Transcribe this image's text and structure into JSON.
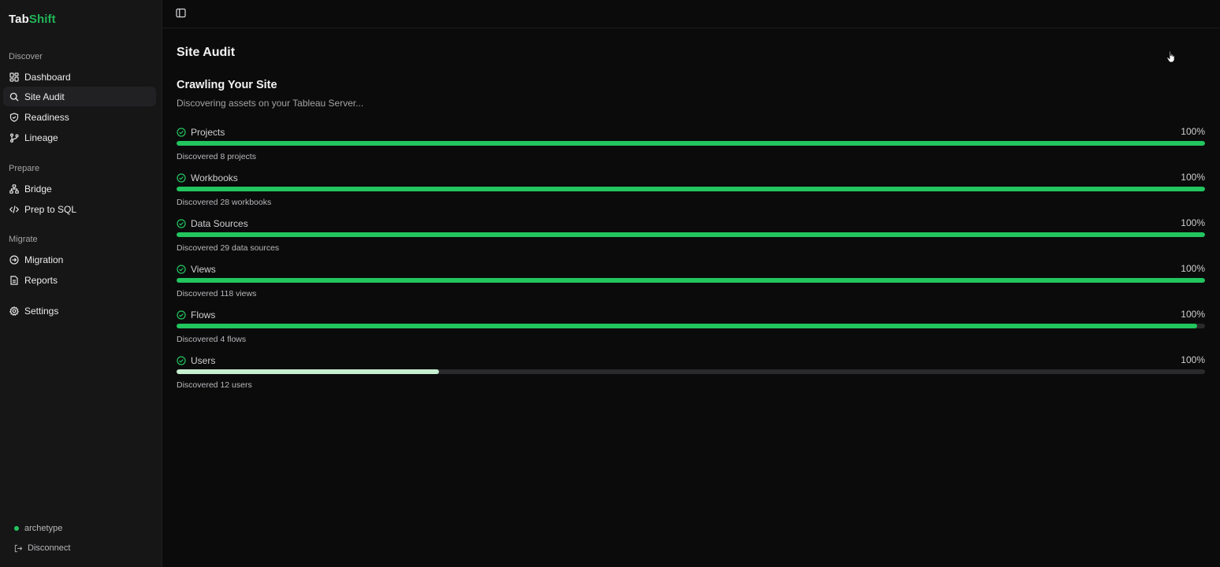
{
  "brand": {
    "part1": "Tab",
    "part2": "Shift"
  },
  "sidebar": {
    "sections": [
      {
        "label": "Discover"
      },
      {
        "label": "Prepare"
      },
      {
        "label": "Migrate"
      }
    ],
    "items": [
      {
        "label": "Dashboard",
        "icon": "grid-icon"
      },
      {
        "label": "Site Audit",
        "icon": "search-icon",
        "active": true
      },
      {
        "label": "Readiness",
        "icon": "shield-icon"
      },
      {
        "label": "Lineage",
        "icon": "branch-icon"
      },
      {
        "label": "Bridge",
        "icon": "network-icon"
      },
      {
        "label": "Prep to SQL",
        "icon": "code-icon"
      },
      {
        "label": "Migration",
        "icon": "arrow-circle-icon"
      },
      {
        "label": "Reports",
        "icon": "document-icon"
      },
      {
        "label": "Settings",
        "icon": "gear-icon"
      }
    ],
    "footer": {
      "user": "archetype",
      "disconnect": "Disconnect",
      "status_color": "#22c55e"
    }
  },
  "main": {
    "title": "Site Audit",
    "crawl_title": "Crawling Your Site",
    "crawl_subtitle": "Discovering assets on your Tableau Server...",
    "progress": [
      {
        "label": "Projects",
        "percent_text": "100%",
        "fill": 1.0,
        "note": "Discovered 8 projects"
      },
      {
        "label": "Workbooks",
        "percent_text": "100%",
        "fill": 1.0,
        "note": "Discovered 28 workbooks"
      },
      {
        "label": "Data Sources",
        "percent_text": "100%",
        "fill": 1.0,
        "note": "Discovered 29 data sources"
      },
      {
        "label": "Views",
        "percent_text": "100%",
        "fill": 1.0,
        "note": "Discovered 118 views"
      },
      {
        "label": "Flows",
        "percent_text": "100%",
        "fill": 0.992,
        "note": "Discovered 4 flows"
      },
      {
        "label": "Users",
        "percent_text": "100%",
        "fill": 0.255,
        "note": "Discovered 12 users",
        "light": true
      }
    ]
  },
  "colors": {
    "accent": "#22c55e",
    "accent_light": "#c6f0cf",
    "brand_accent": "#21b556"
  }
}
